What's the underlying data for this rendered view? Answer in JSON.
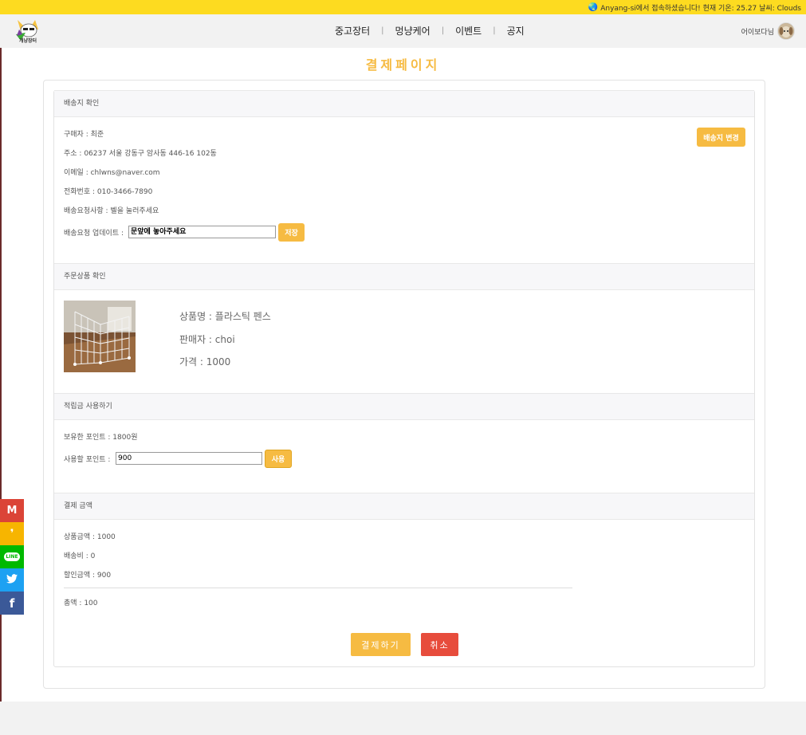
{
  "banner": {
    "text": "Anyang-si에서 접속하셨습니다! 현재 기온: 25.27 날씨: Clouds"
  },
  "nav": {
    "logo_text": "개냥장터",
    "items": [
      "중고장터",
      "멍냥케어",
      "이벤트",
      "공지"
    ],
    "separator": "|",
    "user_name": "어이보다님"
  },
  "page": {
    "title": "결제페이지"
  },
  "shipping": {
    "header": "배송지 확인",
    "buyer": "구매자 : 최준",
    "address": "주소 : 06237 서울 강동구 암사동 446-16 102동",
    "email": "이메일 : chlwns@naver.com",
    "phone": "전화번호 : 010-3466-7890",
    "request": "배송요청사항 : 벨을 눌러주세요",
    "update_label": "배송요청 업데이트 :",
    "update_value": "문앞에 놓아주세요",
    "save_button": "저장",
    "change_button": "배송지 변경"
  },
  "order": {
    "header": "주문상품 확인",
    "product_name": "상품명 : 플라스틱 펜스",
    "seller": "판매자 : choi",
    "price": "가격 : 1000"
  },
  "points": {
    "header": "적립금 사용하기",
    "owned": "보유한 포인트 : 1800원",
    "use_label": "사용할 포인트 :",
    "use_value": "900",
    "use_button": "사용"
  },
  "payment": {
    "header": "결제 금액",
    "product_amount": "상품금액 : 1000",
    "shipping_fee": "배송비 : 0",
    "discount": "할인금액 : 900",
    "total": "총액 : 100",
    "pay_button": "결제하기",
    "cancel_button": "취소"
  },
  "share": [
    {
      "name": "gmail",
      "glyph": "M",
      "color": "#db4437"
    },
    {
      "name": "kakao",
      "glyph": "❜",
      "color": "#f7b500"
    },
    {
      "name": "line",
      "glyph": "LINE",
      "color": "#00b900"
    },
    {
      "name": "twitter",
      "glyph": "🐦",
      "color": "#1da1f2"
    },
    {
      "name": "facebook",
      "glyph": "f",
      "color": "#3b5998"
    }
  ]
}
